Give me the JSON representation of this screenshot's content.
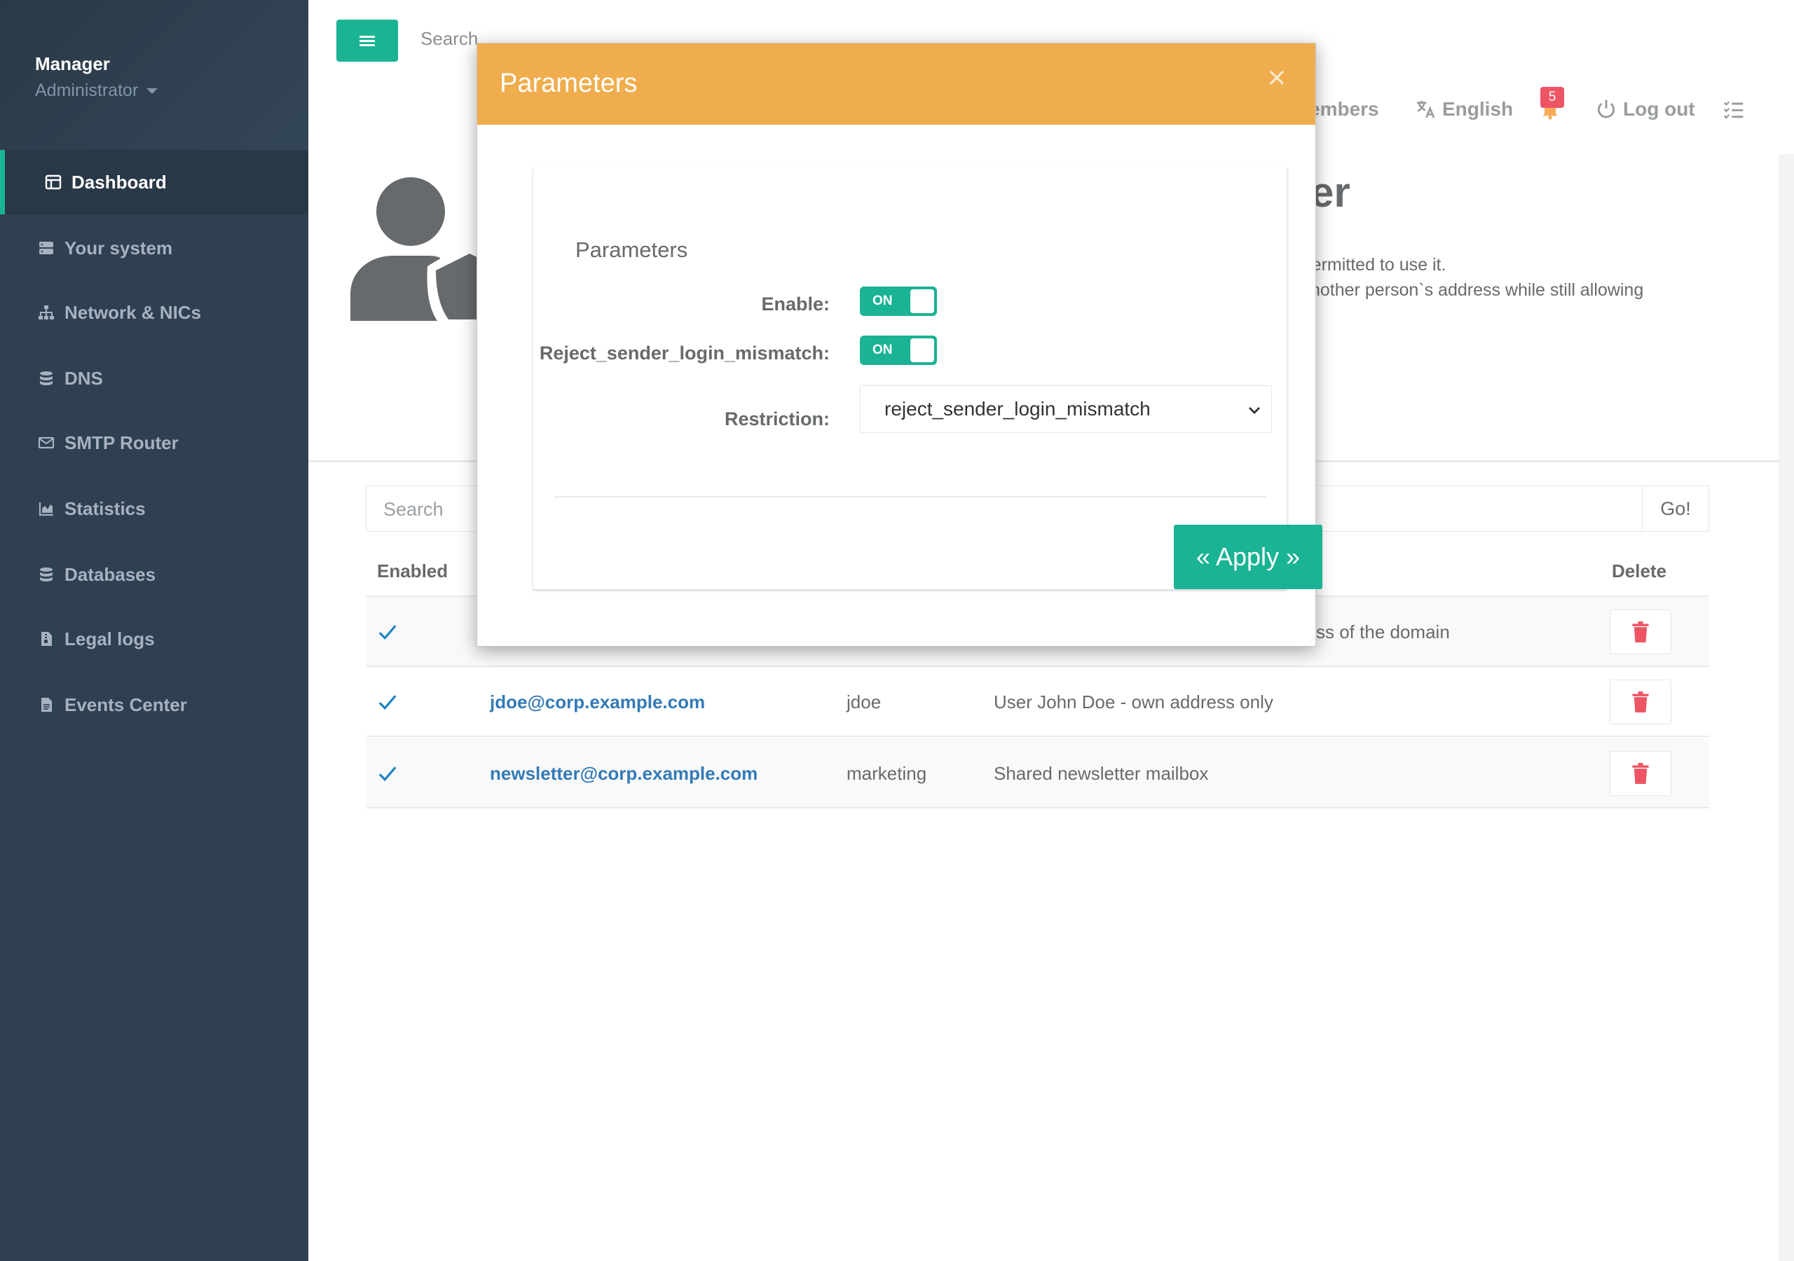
{
  "sidebar": {
    "user_name": "Manager",
    "user_role": "Administrator",
    "items": [
      {
        "label": "Dashboard",
        "icon": "dashboard-icon",
        "active": true
      },
      {
        "label": "Your system",
        "icon": "server-icon"
      },
      {
        "label": "Network & NICs",
        "icon": "sitemap-icon"
      },
      {
        "label": "DNS",
        "icon": "database-icon"
      },
      {
        "label": "SMTP Router",
        "icon": "envelope-icon"
      },
      {
        "label": "Statistics",
        "icon": "area-chart-icon"
      },
      {
        "label": "Databases",
        "icon": "database-icon"
      },
      {
        "label": "Legal logs",
        "icon": "file-archive-icon"
      },
      {
        "label": "Events Center",
        "icon": "file-text-icon"
      }
    ]
  },
  "topbar": {
    "search_placeholder": "Search",
    "members_label": "embers",
    "language_label": "English",
    "notifications_count": "5",
    "logout_label": "Log out"
  },
  "page": {
    "title_fragment": "er",
    "description_line1": "s) permitted to use it.",
    "description_line2": "nother person`s address while still allowing"
  },
  "table": {
    "search_placeholder": "Search",
    "go_label": "Go!",
    "headers": {
      "enabled": "Enabled",
      "delete": "Delete"
    },
    "rows": [
      {
        "enabled": true,
        "email": "",
        "member": "",
        "description": "ss of the domain"
      },
      {
        "enabled": true,
        "email": "jdoe@corp.example.com",
        "member": "jdoe",
        "description": "User John Doe - own address only"
      },
      {
        "enabled": true,
        "email": "newsletter@corp.example.com",
        "member": "marketing",
        "description": "Shared newsletter mailbox"
      }
    ]
  },
  "modal": {
    "title": "Parameters",
    "close_glyph": "×",
    "section_title": "Parameters",
    "enable_label": "Enable:",
    "enable_state": "ON",
    "reject_label": "Reject_sender_login_mismatch:",
    "reject_state": "ON",
    "restriction_label": "Restriction:",
    "restriction_value": "reject_sender_login_mismatch",
    "apply_label": "« Apply »"
  },
  "colors": {
    "sidebar_bg": "#2f4050",
    "accent": "#1ab394",
    "modal_header": "#f0ad4e",
    "danger": "#ed5565",
    "link": "#337ab7"
  }
}
